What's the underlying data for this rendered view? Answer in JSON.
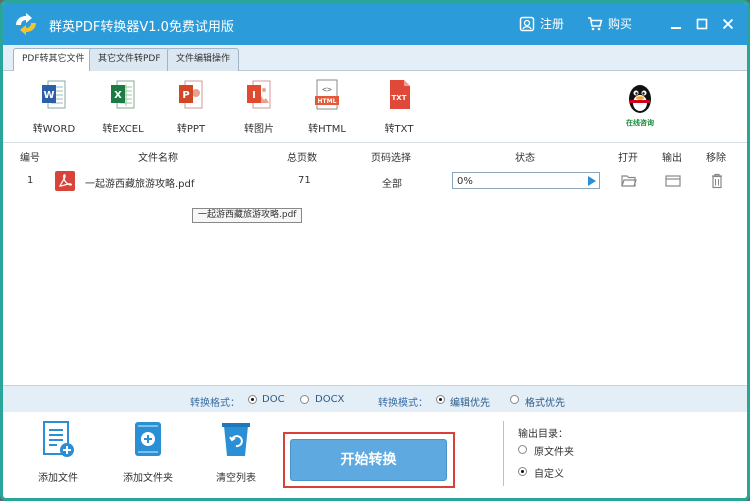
{
  "window": {
    "title": "群英PDF转换器V1.0免费试用版",
    "register_label": "注册",
    "buy_label": "购买"
  },
  "tabs": [
    {
      "label": "PDF转其它文件",
      "active": true
    },
    {
      "label": "其它文件转PDF",
      "active": false
    },
    {
      "label": "文件编辑操作",
      "active": false
    }
  ],
  "toolbar": {
    "tools": [
      {
        "label": "转WORD",
        "icon": "word-icon",
        "badge": "W",
        "color": "#2b5fa8"
      },
      {
        "label": "转EXCEL",
        "icon": "excel-icon",
        "badge": "X",
        "color": "#1e7a44"
      },
      {
        "label": "转PPT",
        "icon": "ppt-icon",
        "badge": "P",
        "color": "#d24625"
      },
      {
        "label": "转图片",
        "icon": "image-icon",
        "badge": "I",
        "color": "#e04a2e"
      },
      {
        "label": "转HTML",
        "icon": "html-icon",
        "badge": "HTML",
        "color": "#e35a3a"
      },
      {
        "label": "转TXT",
        "icon": "txt-icon",
        "badge": "TXT",
        "color": "#e0493a"
      }
    ],
    "support_label": "在线咨询"
  },
  "table": {
    "headers": [
      "编号",
      "文件名称",
      "总页数",
      "页码选择",
      "状态",
      "打开",
      "输出",
      "移除"
    ],
    "rows": [
      {
        "index": "1",
        "filename": "一起游西藏旅游攻略.pdf",
        "pages": "71",
        "range": "全部",
        "progress": "0%"
      }
    ],
    "tooltip": "一起游西藏旅游攻略.pdf"
  },
  "format": {
    "format_label": "转换格式：",
    "format_options": [
      "DOC",
      "DOCX"
    ],
    "format_selected": "DOC",
    "mode_label": "转换模式：",
    "mode_options": [
      "编辑优先",
      "格式优先"
    ],
    "mode_selected": "编辑优先"
  },
  "bottom": {
    "add_file_label": "添加文件",
    "add_folder_label": "添加文件夹",
    "clear_list_label": "清空列表",
    "start_label": "开始转换",
    "output_dir_label": "输出目录：",
    "output_options": [
      "原文件夹",
      "自定义"
    ],
    "output_selected": "自定义"
  },
  "colors": {
    "titlebar": "#2b9bd9",
    "accent": "#5da9e0",
    "highlight_frame": "#d9403a"
  }
}
